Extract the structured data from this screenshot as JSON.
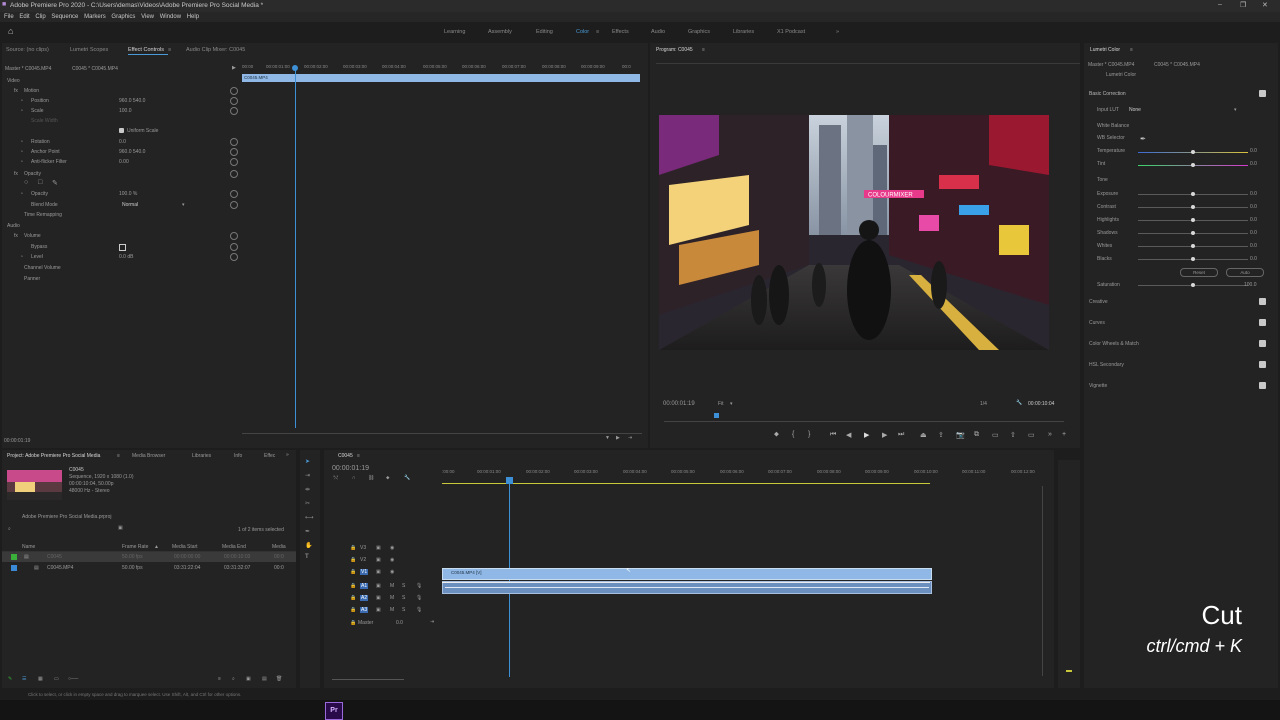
{
  "app_title": "Adobe Premiere Pro 2020 - C:\\Users\\demas\\Videos\\Adobe Premiere Pro Social Media *",
  "menu": [
    "File",
    "Edit",
    "Clip",
    "Sequence",
    "Markers",
    "Graphics",
    "View",
    "Window",
    "Help"
  ],
  "workspaces": [
    "Learning",
    "Assembly",
    "Editing",
    "Color",
    "Effects",
    "Audio",
    "Graphics",
    "Libraries",
    "X1 Podcast"
  ],
  "source_tabs": {
    "source": "Source: (no clips)",
    "scopes": "Lumetri Scopes",
    "effect_controls": "Effect Controls",
    "mixer": "Audio Clip Mixer: C0045"
  },
  "effect_controls": {
    "master": "Master * C0045.MP4",
    "clip": "C0045 * C0045.MP4",
    "ruler": [
      "00:00",
      "00:00:01:00",
      "00:00:02:00",
      "00:00:03:00",
      "00:00:04:00",
      "00:00:05:00",
      "00:00:06:00",
      "00:00:07:00",
      "00:00:08:00",
      "00:00:09:00",
      "00:0"
    ],
    "clipbar": "C0045.MP4",
    "video": "Video",
    "motion": "Motion",
    "position": "Position",
    "position_val": "960.0   540.0",
    "scale": "Scale",
    "scale_val": "100.0",
    "scale_width": "Scale Width",
    "uniform": "Uniform Scale",
    "rotation": "Rotation",
    "rotation_val": "0.0",
    "anchor": "Anchor Point",
    "anchor_val": "960.0   540.0",
    "flicker": "Anti-flicker Filter",
    "flicker_val": "0.00",
    "opacity": "Opacity",
    "opacity_prop": "Opacity",
    "opacity_val": "100.0 %",
    "blend": "Blend Mode",
    "blend_val": "Normal",
    "remap": "Time Remapping",
    "audio": "Audio",
    "volume": "Volume",
    "bypass": "Bypass",
    "level": "Level",
    "level_val": "0.0 dB",
    "channel": "Channel Volume",
    "panner": "Panner",
    "timecode": "00:00:01:19"
  },
  "program": {
    "tab": "Program: C0045",
    "timecode": "00:00:01:19",
    "fit": "Fit",
    "ratio": "1/4",
    "duration": "00:00:10:04",
    "overlay_text": "COLOURMIXER"
  },
  "lumetri": {
    "tab": "Lumetri Color",
    "master": "Master * C0045.MP4",
    "clip": "C0045 * C0045.MP4",
    "effect": "Lumetri Color",
    "basic": "Basic Correction",
    "input_lut": "Input LUT",
    "input_lut_val": "None",
    "wb": "White Balance",
    "wb_selector": "WB Selector",
    "temperature": "Temperature",
    "tint": "Tint",
    "tone": "Tone",
    "exposure": "Exposure",
    "contrast": "Contrast",
    "highlights": "Highlights",
    "shadows": "Shadows",
    "whites": "Whites",
    "blacks": "Blacks",
    "reset": "Reset",
    "auto": "Auto",
    "saturation": "Saturation",
    "sat_val": "100.0",
    "zero": "0.0",
    "sections": [
      "Creative",
      "Curves",
      "Color Wheels & Match",
      "HSL Secondary",
      "Vignette"
    ]
  },
  "project": {
    "tabs": [
      "Project: Adobe Premiere Pro Social Media",
      "Media Browser",
      "Libraries",
      "Info",
      "Effec"
    ],
    "item_name": "C0045",
    "item_info1": "Sequence, 1920 x 1080 (1.0)",
    "item_info2": "00:00:10:04, 50.00p",
    "item_info3": "48000 Hz - Stereo",
    "file": "Adobe Premiere Pro Social Media.prproj",
    "count": "1 of 2 items selected",
    "columns": [
      "Name",
      "Frame Rate",
      "Media Start",
      "Media End",
      "Media"
    ],
    "rows": [
      {
        "name": "C0045",
        "rate": "50.00 fps",
        "start": "00:00:00:00",
        "end": "00:00:10:03",
        "media": "00:0"
      },
      {
        "name": "C0045.MP4",
        "rate": "50.00 fps",
        "start": "03:31:22:04",
        "end": "03:31:32:07",
        "media": "00:0"
      }
    ]
  },
  "timeline": {
    "tab": "C0045",
    "timecode": "00:00:01:19",
    "ruler": [
      ":00:00",
      "00:00:01:00",
      "00:00:02:00",
      "00:00:03:00",
      "00:00:04:00",
      "00:00:05:00",
      "00:00:06:00",
      "00:00:07:00",
      "00:00:08:00",
      "00:00:09:00",
      "00:00:10:00",
      "00:00:11:00",
      "00:00:12:00"
    ],
    "tracks": [
      "V3",
      "V2",
      "V1",
      "A1",
      "A2",
      "A3"
    ],
    "master": "Master",
    "master_val": "0.0",
    "clip_label": "C0045.MP4 [V]"
  },
  "overlay": {
    "title": "Cut",
    "shortcut": "ctrl/cmd + K"
  },
  "status": "Click to select, or click in empty space and drag to marquee select. Use Shift, Alt, and Ctrl for other options.",
  "taskbar_icon": "Pr",
  "colors": {
    "accent": "#4a9ad6",
    "clip": "#8fb8e6",
    "playhead": "#3d8fd6"
  }
}
